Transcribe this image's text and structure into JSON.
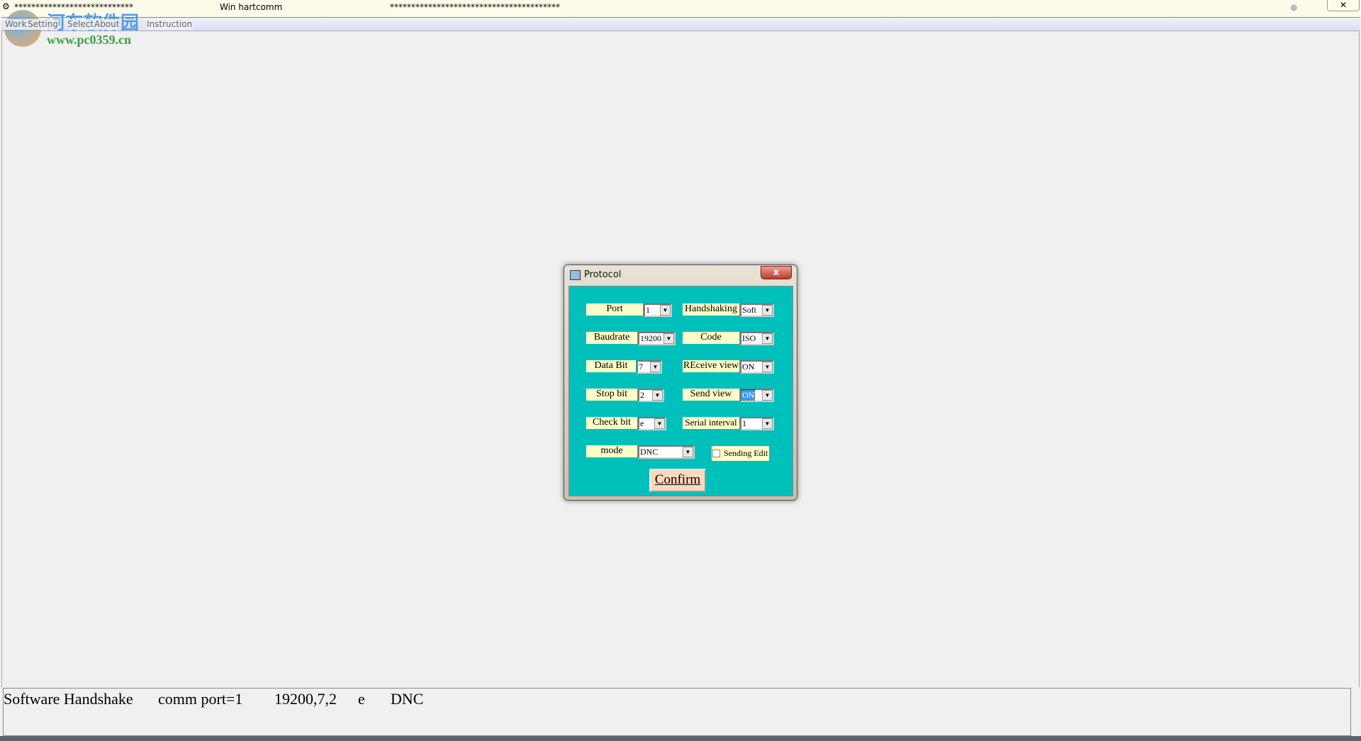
{
  "window": {
    "title": "Win hartcomm",
    "left_stars": "****************************",
    "right_stars": "****************************************"
  },
  "menu": [
    "Work",
    "Setting",
    "Select",
    "About",
    "Instruction"
  ],
  "watermark": {
    "name": "河东软件园",
    "url": "www.pc0359.cn"
  },
  "dialog": {
    "title": "Protocol",
    "close": "x",
    "fields": {
      "port": {
        "label": "Port",
        "value": "1"
      },
      "baudrate": {
        "label": "Baudrate",
        "value": "19200"
      },
      "databit": {
        "label": "Data Bit",
        "value": "7"
      },
      "stopbit": {
        "label": "Stop bit",
        "value": "2"
      },
      "checkbit": {
        "label": "Check bit",
        "value": "e"
      },
      "mode": {
        "label": "mode",
        "value": "DNC"
      },
      "handshaking": {
        "label": "Handshaking",
        "value": "Soft"
      },
      "code": {
        "label": "Code",
        "value": "ISO"
      },
      "receive": {
        "label": "REceive view",
        "value": "ON"
      },
      "send": {
        "label": "Send view",
        "value": "ON"
      },
      "interval": {
        "label": "Serial interval",
        "value": "1"
      }
    },
    "sending_edit": {
      "label": "Sending Edit",
      "checked": false
    },
    "confirm": "Confirm",
    "bg_color": "#00C0BC",
    "label_color": "#FDFDC8"
  },
  "status": {
    "handshake": "Software Handshake",
    "port": "comm port=1",
    "params": "19200,7,2",
    "check": "e",
    "mode": "DNC"
  }
}
